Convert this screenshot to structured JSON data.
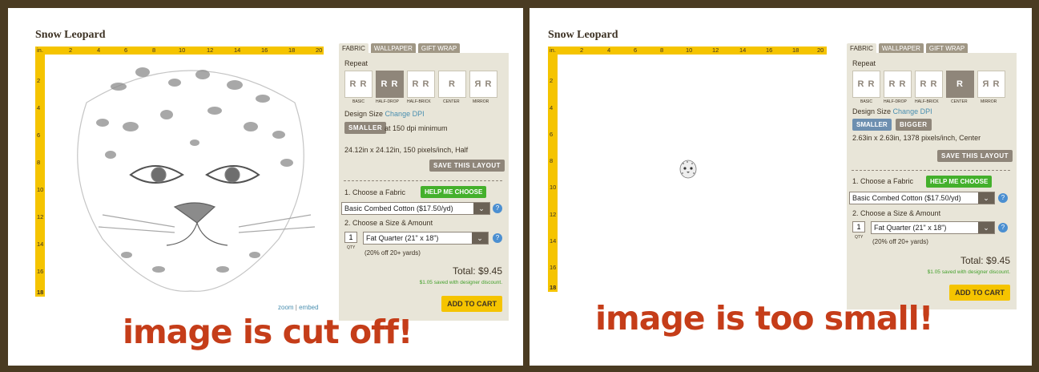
{
  "left": {
    "title": "Snow Leopard",
    "tabs": [
      "FABRIC",
      "WALLPAPER",
      "GIFT WRAP"
    ],
    "repeat_label": "Repeat",
    "repeat_options": [
      "BASIC",
      "HALF-DROP",
      "HALF-BRICK",
      "CENTER",
      "MIRROR"
    ],
    "selected_repeat": "HALF-DROP",
    "design_size_label": "Design Size",
    "change_dpi": "Change DPI",
    "smaller": "SMALLER",
    "dpi_note": "at 150 dpi minimum",
    "dimensions": "24.12in x 24.12in, 150 pixels/inch, Half",
    "save_layout": "SAVE THIS LAYOUT",
    "choose_fabric": "1. Choose a Fabric",
    "help_choose": "HELP ME CHOOSE",
    "fabric_value": "Basic Combed Cotton ($17.50/yd)",
    "choose_size": "2. Choose a Size & Amount",
    "qty": "1",
    "qty_label": "QTY",
    "size_value": "Fat Quarter (21\" x 18\")",
    "discount": "(20% off 20+ yards)",
    "total": "Total: $9.45",
    "saved": "$1.05 saved with designer discount.",
    "add_to_cart": "ADD TO CART",
    "zoom": "zoom",
    "embed": "embed",
    "caption": "image is cut off!"
  },
  "right": {
    "title": "Snow Leopard",
    "tabs": [
      "FABRIC",
      "WALLPAPER",
      "GIFT WRAP"
    ],
    "repeat_label": "Repeat",
    "repeat_options": [
      "BASIC",
      "HALF-DROP",
      "HALF-BRICK",
      "CENTER",
      "MIRROR"
    ],
    "selected_repeat": "CENTER",
    "design_size_label": "Design Size",
    "change_dpi": "Change DPI",
    "smaller": "SMALLER",
    "bigger": "BIGGER",
    "dimensions": "2.63in x 2.63in, 1378 pixels/inch, Center",
    "save_layout": "SAVE THIS LAYOUT",
    "choose_fabric": "1. Choose a Fabric",
    "help_choose": "HELP ME CHOOSE",
    "fabric_value": "Basic Combed Cotton ($17.50/yd)",
    "choose_size": "2. Choose a Size & Amount",
    "qty": "1",
    "qty_label": "QTY",
    "size_value": "Fat Quarter (21\" x 18\")",
    "discount": "(20% off 20+ yards)",
    "total": "Total: $9.45",
    "saved": "$1.05 saved with designer discount.",
    "add_to_cart": "ADD TO CART",
    "caption": "image is too small!"
  },
  "ruler": {
    "unit": "in.",
    "h_labels": [
      "2",
      "4",
      "6",
      "8",
      "10",
      "12",
      "14",
      "16",
      "18",
      "20"
    ],
    "v_labels": [
      "2",
      "4",
      "6",
      "8",
      "10",
      "12",
      "14",
      "16",
      "18"
    ]
  },
  "colors": {
    "ruler": "#f5c400",
    "panel": "#e8e5d8",
    "button_gray": "#8f867a",
    "button_green": "#44b02c",
    "caption": "#c53d19",
    "frame": "#4a3b22"
  }
}
